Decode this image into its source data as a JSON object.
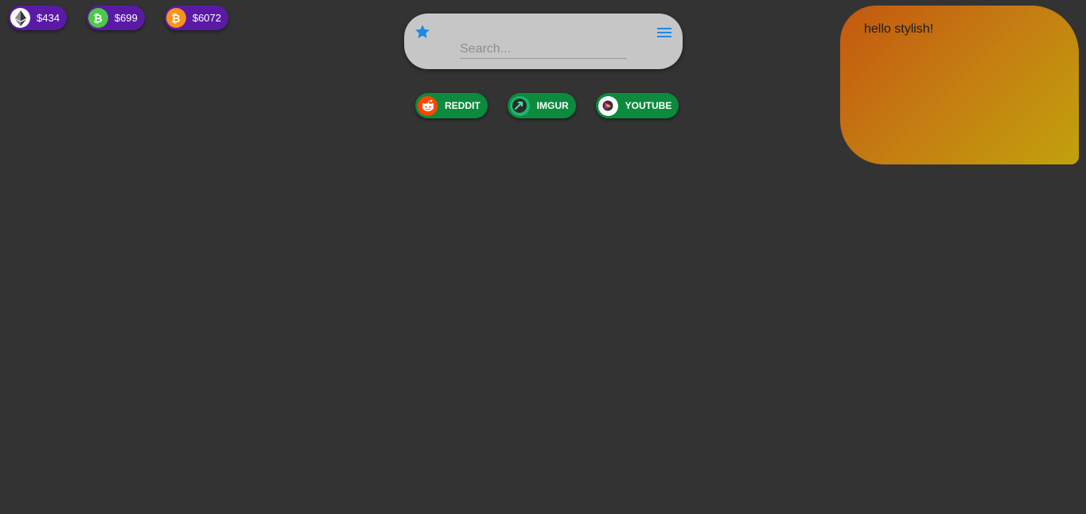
{
  "tickers": [
    {
      "coin": "ethereum",
      "icon": "ethereum-icon",
      "price": "$434",
      "color": "#ffffff"
    },
    {
      "coin": "bitcoin-cash",
      "icon": "bitcoin-cash-icon",
      "price": "$699",
      "color": "#4cc947"
    },
    {
      "coin": "bitcoin",
      "icon": "bitcoin-icon",
      "price": "$6072",
      "color": "#f7931a"
    }
  ],
  "search": {
    "placeholder": "Search...",
    "value": "",
    "star_icon": "star-icon",
    "menu_icon": "hamburger-menu-icon",
    "accent": "#1e88e5"
  },
  "links": [
    {
      "label": "REDDIT",
      "icon": "reddit-icon"
    },
    {
      "label": "IMGUR",
      "icon": "imgur-icon"
    },
    {
      "label": "YOUTUBE",
      "icon": "youtube-icon"
    }
  ],
  "note": {
    "text": "hello stylish!"
  },
  "colors": {
    "background": "#333333",
    "ticker_bg": "#5a1aa6",
    "link_bg": "#0c8a3e",
    "search_bg": "#c6c6c6"
  }
}
